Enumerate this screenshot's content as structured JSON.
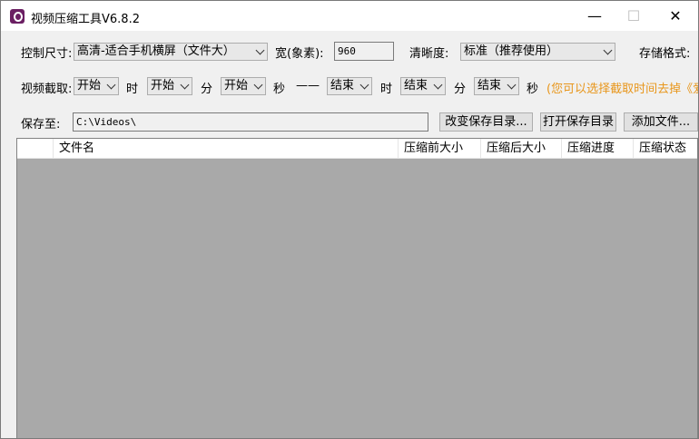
{
  "window": {
    "title": "视频压缩工具V6.8.2",
    "minimize_glyph": "—",
    "maximize_glyph": "☐",
    "close_glyph": "✕"
  },
  "row1": {
    "size_label": "控制尺寸:",
    "size_value": "高清-适合手机横屏（文件大）",
    "width_label": "宽(象素):",
    "width_value": "960",
    "clarity_label": "清晰度:",
    "clarity_value": "标准（推荐使用）",
    "format_label": "存储格式:"
  },
  "row2": {
    "clip_label": "视频截取:",
    "start_hour": "开始",
    "hour_unit": "时",
    "start_min": "开始",
    "min_unit": "分",
    "start_sec": "开始",
    "sec_unit": "秒",
    "separator": "——",
    "end_hour": "结束",
    "end_hour_unit": "时",
    "end_min": "结束",
    "end_min_unit": "分",
    "end_sec": "结束",
    "end_sec_unit": "秒",
    "hint": "(您可以选择截取时间去掉《爱"
  },
  "row3": {
    "save_label": "保存至:",
    "save_path": "C:\\Videos\\",
    "change_dir_button": "改变保存目录...",
    "open_dir_button": "打开保存目录",
    "add_file_button": "添加文件..."
  },
  "table": {
    "columns": [
      "",
      "文件名",
      "压缩前大小",
      "压缩后大小",
      "压缩进度",
      "压缩状态"
    ],
    "rows": []
  },
  "colors": {
    "hint": "#e8961b",
    "list_background": "#a9a9a9",
    "window_background": "#f0f0f0"
  }
}
